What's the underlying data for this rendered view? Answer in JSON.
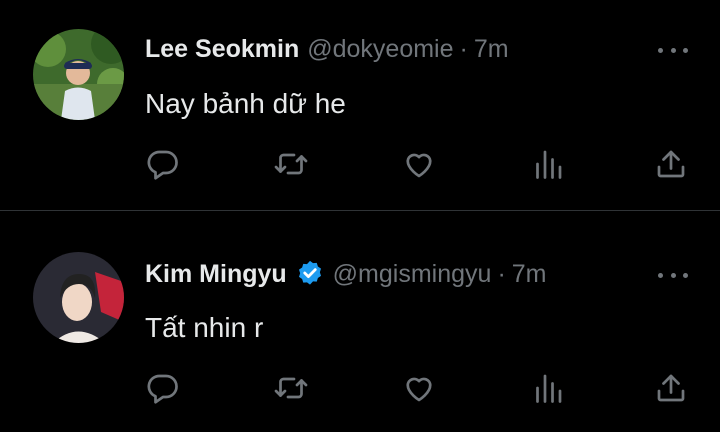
{
  "tweets": [
    {
      "name": "Lee Seokmin",
      "handle": "@dokyeomie",
      "separator": "·",
      "time": "7m",
      "text": "Nay bảnh dữ he",
      "verified": false,
      "avatar_icon": "profile-photo"
    },
    {
      "name": "Kim Mingyu",
      "handle": "@mgismingyu",
      "separator": "·",
      "time": "7m",
      "text": "Tất nhin r",
      "verified": true,
      "avatar_icon": "profile-photo"
    }
  ],
  "action_icons": [
    "reply-icon",
    "retweet-icon",
    "like-icon",
    "views-icon",
    "share-icon"
  ],
  "colors": {
    "background": "#000000",
    "primary_text": "#e7e9ea",
    "secondary_text": "#71767b",
    "divider": "#2f3336",
    "verified": "#1d9bf0"
  }
}
